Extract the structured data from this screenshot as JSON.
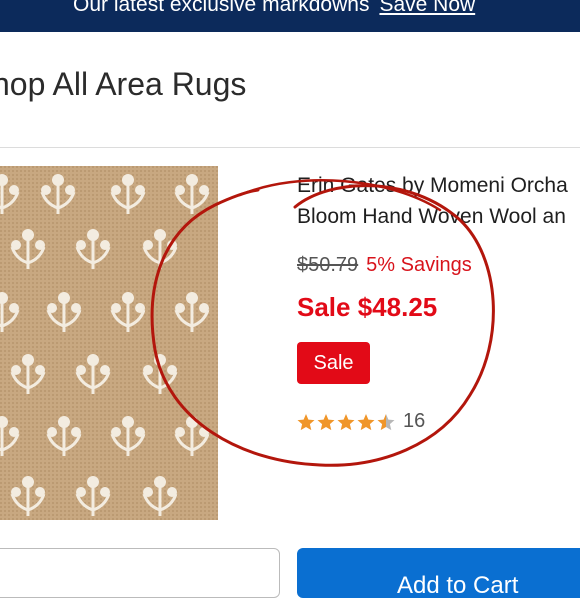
{
  "banner": {
    "text": "Our latest exclusive markdowns",
    "link_label": "Save Now",
    "background": "#0c2a5b"
  },
  "page_heading": "hop All Area Rugs",
  "product": {
    "title_line1": "Erin Gates by Momeni Orcha",
    "title_line2": "Bloom Hand Woven Wool an",
    "was_price": "$50.79",
    "savings_text": "5% Savings",
    "sale_price": "Sale $48.25",
    "sale_badge": "Sale",
    "rating": 4.5,
    "review_count": "16",
    "image_icon": "rug-pattern-image"
  },
  "buttons": {
    "add_to_cart_label": "Add to Cart"
  },
  "colors": {
    "sale_red": "#e20a17",
    "star_orange": "#f0962a",
    "annotation_red": "#b3160c",
    "cart_blue": "#0a6fd1"
  }
}
